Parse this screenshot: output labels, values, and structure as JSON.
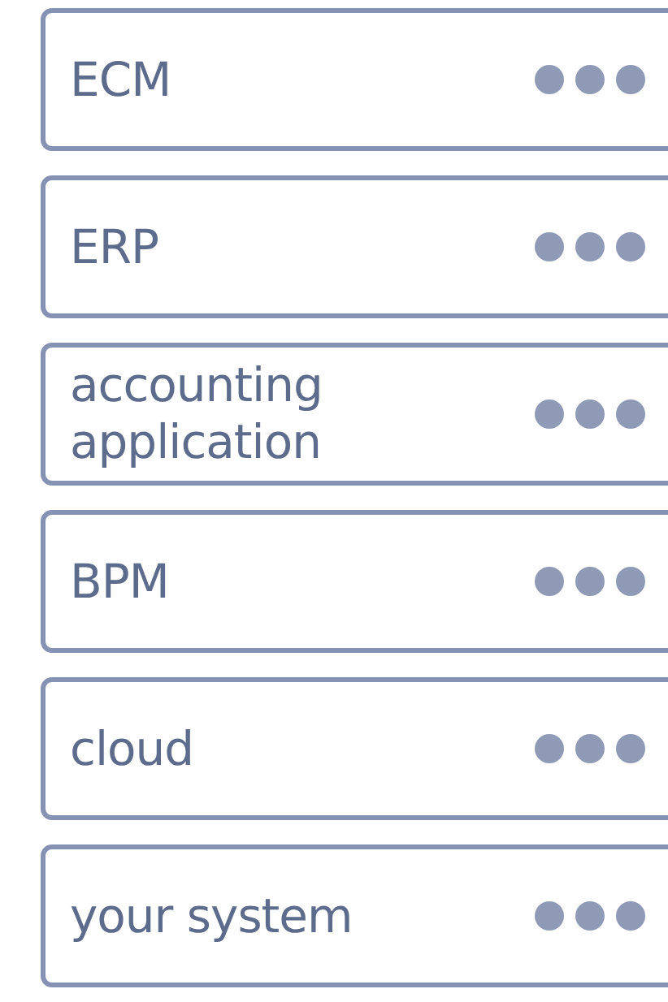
{
  "items": [
    {
      "label": "ECM"
    },
    {
      "label": "ERP"
    },
    {
      "label": "accounting application"
    },
    {
      "label": "BPM"
    },
    {
      "label": "cloud"
    },
    {
      "label": "your system"
    }
  ]
}
